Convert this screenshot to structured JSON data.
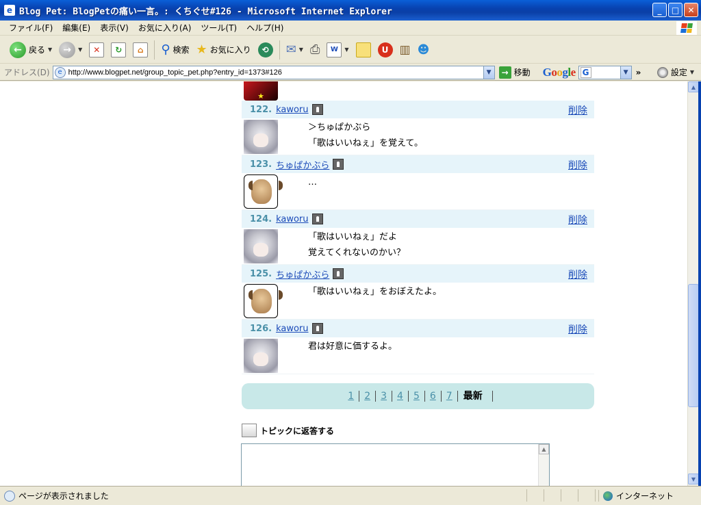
{
  "window": {
    "title": "Blog Pet: BlogPetの痛い一言。: くちぐせ#126 - Microsoft Internet Explorer"
  },
  "menu": [
    "ファイル(F)",
    "編集(E)",
    "表示(V)",
    "お気に入り(A)",
    "ツール(T)",
    "ヘルプ(H)"
  ],
  "toolbar": {
    "back": "戻る",
    "search": "検索",
    "favorites": "お気に入り"
  },
  "address": {
    "label": "アドレス(D)",
    "url": "http://www.blogpet.net/group_topic_pet.php?entry_id=1373#126",
    "go": "移動",
    "settings": "設定"
  },
  "delete_label": "削除",
  "posts": [
    {
      "num": "122.",
      "user": "kaworu",
      "avatar": "kaworu",
      "lines": [
        "＞ちゅぱかぶら",
        "「歌はいいねぇ」を覚えて。"
      ]
    },
    {
      "num": "123.",
      "user": "ちゅぱかぶら",
      "avatar": "dog",
      "lines": [
        "…"
      ]
    },
    {
      "num": "124.",
      "user": "kaworu",
      "avatar": "kaworu",
      "lines": [
        "「歌はいいねぇ」だよ",
        "覚えてくれないのかい？"
      ]
    },
    {
      "num": "125.",
      "user": "ちゅぱかぶら",
      "avatar": "dog",
      "lines": [
        "「歌はいいねぇ」をおぼえたよ。"
      ]
    },
    {
      "num": "126.",
      "user": "kaworu",
      "avatar": "kaworu",
      "lines": [
        "君は好意に価するよ。"
      ]
    }
  ],
  "pager": {
    "pages": [
      "1",
      "2",
      "3",
      "4",
      "5",
      "6",
      "7"
    ],
    "latest": "最新"
  },
  "reply": {
    "heading": "トピックに返答する"
  },
  "status": {
    "text": "ページが表示されました",
    "zone": "インターネット"
  }
}
